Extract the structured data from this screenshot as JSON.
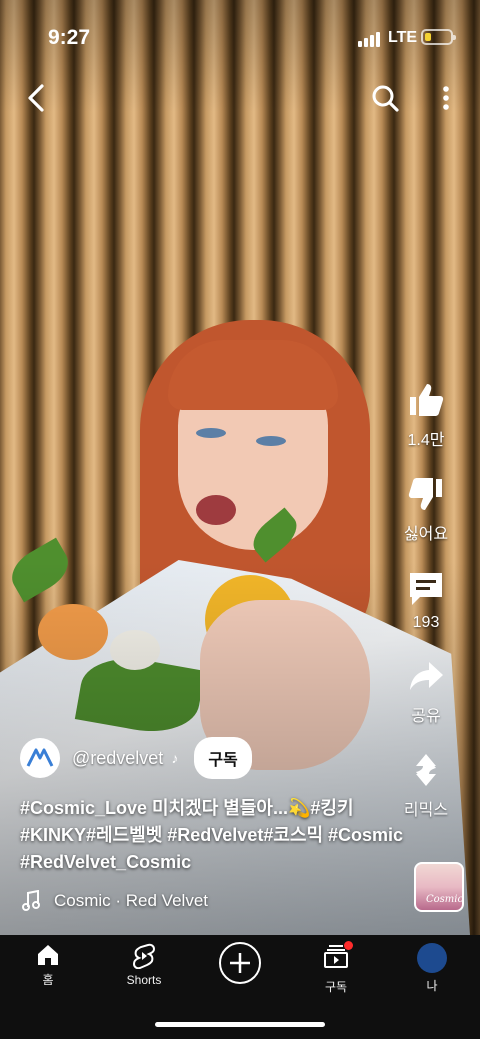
{
  "status_bar": {
    "time": "9:27",
    "network": "LTE",
    "battery_color": "#f4d233",
    "battery_level": 0.25
  },
  "top_bar": {
    "back_icon": "chevron-left-icon",
    "search_icon": "search-icon",
    "more_icon": "more-vert-icon"
  },
  "actions": {
    "like_count": "1.4만",
    "dislike_label": "싫어요",
    "comment_count": "193",
    "share_label": "공유",
    "remix_label": "리믹스",
    "remix_thumb_text": "Cosmic"
  },
  "channel": {
    "handle": "@redvelvet",
    "subscribe_label": "구독"
  },
  "caption": "#Cosmic_Love 미치겠다 별들아...💫#킹키 #KINKY#레드벨벳 #RedVelvet#코스믹 #Cosmic #RedVelvet_Cosmic",
  "music": {
    "track": "Cosmic · Red Velvet"
  },
  "nav": {
    "home_label": "홈",
    "shorts_label": "Shorts",
    "subscriptions_label": "구독",
    "you_label": "나"
  },
  "colors": {
    "notification_dot": "#ff2b2b",
    "nav_bg": "#0f0f0f",
    "avatar_me": "#1d4a8f"
  }
}
